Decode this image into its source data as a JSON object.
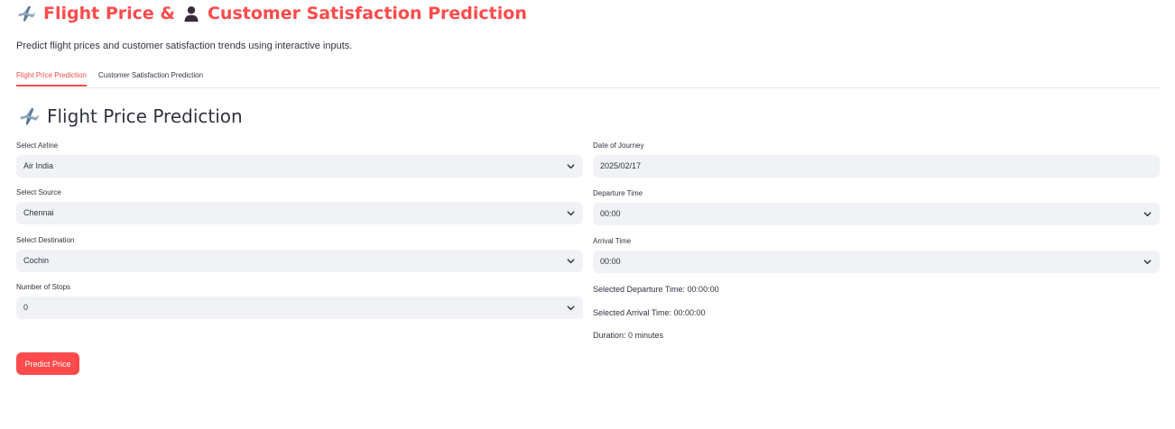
{
  "header": {
    "title_part1": "Flight Price &",
    "title_part2": "Customer Satisfaction Prediction",
    "subtitle": "Predict flight prices and customer satisfaction trends using interactive inputs."
  },
  "tabs": [
    {
      "label": "Flight Price Prediction",
      "active": true
    },
    {
      "label": "Customer Satisfaction Prediction",
      "active": false
    }
  ],
  "section": {
    "title": "Flight Price Prediction"
  },
  "form": {
    "airline": {
      "label": "Select Airline",
      "value": "Air India"
    },
    "source": {
      "label": "Select Source",
      "value": "Chennai"
    },
    "destination": {
      "label": "Select Destination",
      "value": "Cochin"
    },
    "stops": {
      "label": "Number of Stops",
      "value": "0"
    },
    "date": {
      "label": "Date of Journey",
      "value": "2025/02/17"
    },
    "departure": {
      "label": "Departure Time",
      "value": "00:00"
    },
    "arrival": {
      "label": "Arrival Time",
      "value": "00:00"
    }
  },
  "info": {
    "selected_departure": "Selected Departure Time: 00:00:00",
    "selected_arrival": "Selected Arrival Time: 00:00:00",
    "duration": "Duration: 0 minutes"
  },
  "actions": {
    "predict_label": "Predict Price"
  },
  "icons": {
    "plane": "airplane-icon",
    "person": "person-icon",
    "chevron": "chevron-down-icon"
  },
  "colors": {
    "accent": "#ff4b4b",
    "input_bg": "#f0f2f6",
    "text": "#31333f"
  }
}
